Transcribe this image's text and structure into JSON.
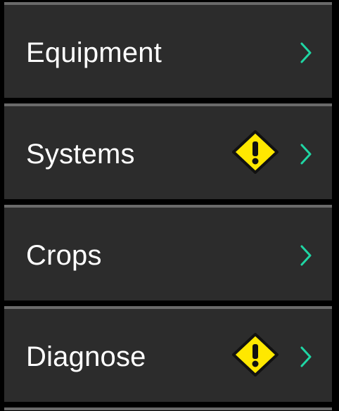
{
  "menu": {
    "items": [
      {
        "label": "Equipment",
        "warning": false
      },
      {
        "label": "Systems",
        "warning": true
      },
      {
        "label": "Crops",
        "warning": false
      },
      {
        "label": "Diagnose",
        "warning": true
      }
    ]
  },
  "icons": {
    "warning": "warning-icon",
    "chevron": "chevron-right-icon"
  },
  "colors": {
    "background": "#000000",
    "item_background": "#2c2c2c",
    "item_border": "#6a6a6a",
    "label": "#ffffff",
    "chevron": "#1fd6a4",
    "warning_fill": "#ffe800",
    "warning_outline": "#111111"
  }
}
